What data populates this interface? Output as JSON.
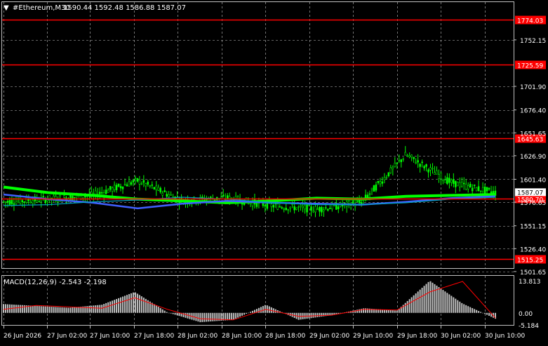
{
  "window": {
    "symbol_title": "#Ethereum,M30",
    "ohlc": "1590.44 1592.48 1586.88 1587.07",
    "title_marker": "▼"
  },
  "colors": {
    "background": "#000000",
    "frame": "#c0c0c0",
    "grid": "#c0c0c0",
    "candles": "#00ff00",
    "text": "#ffffff",
    "level_line": "#ff0000",
    "level_label_bg": "#ff0000",
    "ma_fast": "#4060ff",
    "ma_mid": "#00a0c0",
    "ma_slow": "#00ff00",
    "macd_hist": "#c0c0c0",
    "macd_signal": "#ff0000",
    "current_price_bg": "#ffffff"
  },
  "price_axis": {
    "ticks": [
      "1752.15",
      "1701.90",
      "1676.40",
      "1651.65",
      "1626.90",
      "1601.40",
      "1576.65",
      "1551.15",
      "1526.40",
      "1501.65"
    ],
    "current_price": "1587.07"
  },
  "levels": [
    {
      "label": "1774.03"
    },
    {
      "label": "1725.59"
    },
    {
      "label": "1645.63"
    },
    {
      "label": "1580.70"
    },
    {
      "label": "1515.25"
    }
  ],
  "macd": {
    "title": "MACD(12,26,9) -2.543 -2.198",
    "ticks": [
      "13.813",
      "0.00",
      "-5.184"
    ]
  },
  "time_axis": {
    "labels": [
      "26 Jun 2026",
      "27 Jun 02:00",
      "27 Jun 10:00",
      "27 Jun 18:00",
      "28 Jun 02:00",
      "28 Jun 10:00",
      "28 Jun 18:00",
      "29 Jun 02:00",
      "29 Jun 10:00",
      "29 Jun 18:00",
      "30 Jun 02:00",
      "30 Jun 10:00"
    ]
  },
  "chart_data": {
    "type": "line",
    "symbol": "#Ethereum",
    "timeframe": "M30",
    "y_range": [
      1501.65,
      1774.03
    ],
    "horizontal_levels": [
      1774.03,
      1725.59,
      1645.63,
      1580.7,
      1515.25
    ],
    "last_ohlc": {
      "open": 1590.44,
      "high": 1592.48,
      "low": 1586.88,
      "close": 1587.07
    },
    "x": [
      "26 Jun 2026",
      "27 Jun 02:00",
      "27 Jun 10:00",
      "27 Jun 18:00",
      "28 Jun 02:00",
      "28 Jun 10:00",
      "28 Jun 18:00",
      "29 Jun 02:00",
      "29 Jun 10:00",
      "29 Jun 18:00",
      "30 Jun 02:00",
      "30 Jun 10:00"
    ],
    "series": [
      {
        "name": "Close",
        "values": [
          1577,
          1580,
          1584,
          1600,
          1578,
          1581,
          1573,
          1569,
          1576,
          1628,
          1598,
          1587
        ]
      },
      {
        "values": [
          1593,
          1587,
          1584,
          1580,
          1578,
          1576,
          1578,
          1581,
          1580,
          1583,
          1584,
          1585
        ]
      },
      {
        "values": [
          1585,
          1580,
          1576,
          1570,
          1575,
          1578,
          1576,
          1575,
          1574,
          1577,
          1581,
          1583
        ]
      },
      {
        "values": [
          1573,
          1574,
          1577,
          1579,
          1582,
          1580,
          1576,
          1574,
          1574,
          1576,
          1580,
          1582
        ]
      }
    ],
    "macd": {
      "range": [
        -5.184,
        13.813
      ],
      "histogram": [
        3.8,
        3.0,
        2.2,
        3.5,
        9.0,
        0.2,
        -4.0,
        -3.0,
        3.5,
        -3.0,
        -1.0,
        2.0,
        1.0,
        13.8,
        4.0,
        -2.5
      ],
      "signal": [
        1.5,
        3.2,
        2.6,
        2.0,
        6.5,
        1.5,
        -2.5,
        -3.0,
        1.5,
        -1.5,
        -1.0,
        1.5,
        1.2,
        9.0,
        13.5,
        -2.2
      ]
    }
  }
}
